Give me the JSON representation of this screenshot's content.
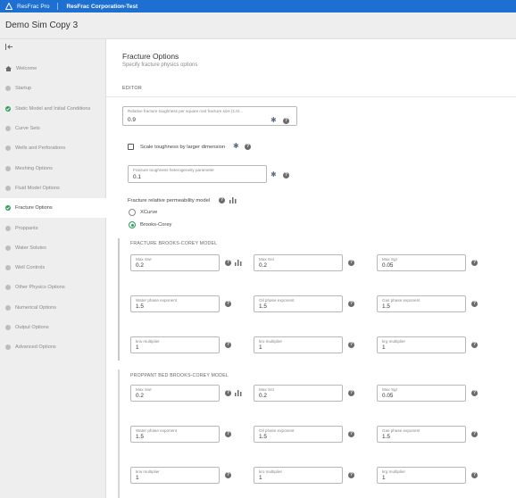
{
  "topbar": {
    "app": "ResFrac Pro",
    "org": "ResFrac Corporation-Test"
  },
  "sim": {
    "title": "Demo Sim Copy 3"
  },
  "sidebar": {
    "items": [
      {
        "label": "Welcome",
        "status": "home"
      },
      {
        "label": "Startup",
        "status": "none"
      },
      {
        "label": "Static Model and Initial Conditions",
        "status": "ok"
      },
      {
        "label": "Curve Sets",
        "status": "none"
      },
      {
        "label": "Wells and Perforations",
        "status": "none"
      },
      {
        "label": "Meshing Options",
        "status": "none"
      },
      {
        "label": "Fluid Model Options",
        "status": "none"
      },
      {
        "label": "Fracture Options",
        "status": "ok",
        "active": true
      },
      {
        "label": "Proppants",
        "status": "none"
      },
      {
        "label": "Water Solutes",
        "status": "none"
      },
      {
        "label": "Well Controls",
        "status": "none"
      },
      {
        "label": "Other Physics Options",
        "status": "none"
      },
      {
        "label": "Numerical Options",
        "status": "none"
      },
      {
        "label": "Output Options",
        "status": "none"
      },
      {
        "label": "Advanced Options",
        "status": "none"
      }
    ]
  },
  "main": {
    "title": "Fracture Options",
    "subtitle": "Specify fracture physics options",
    "tab": "EDITOR",
    "toughness": {
      "label": "Relative fracture toughness per square root fracture size (1.0/...",
      "value": "0.9"
    },
    "scale_label": "Scale toughness by larger dimension",
    "heterogeneity": {
      "label": "Fracture toughness heterogeneity parameter",
      "value": "0.1"
    },
    "relperm_label": "Fracture relative permeability model",
    "radio_xcurve": "XCurve",
    "radio_bc": "Brooks-Corey",
    "fracture_bc": {
      "heading": "FRACTURE BROOKS-COREY MODEL",
      "row1": [
        {
          "label": "Max Swr",
          "value": "0.2"
        },
        {
          "label": "Max Sor",
          "value": "0.2"
        },
        {
          "label": "Max Sgr",
          "value": "0.05"
        }
      ],
      "row2": [
        {
          "label": "Water phase exponent",
          "value": "1.5"
        },
        {
          "label": "Oil phase exponent",
          "value": "1.5"
        },
        {
          "label": "Gas phase exponent",
          "value": "1.5"
        }
      ],
      "row3": [
        {
          "label": "krw multiplier",
          "value": "1"
        },
        {
          "label": "kro multiplier",
          "value": "1"
        },
        {
          "label": "krg multiplier",
          "value": "1"
        }
      ]
    },
    "proppant_bc": {
      "heading": "PROPPANT BED BROOKS-COREY MODEL",
      "row1": [
        {
          "label": "Max Swr",
          "value": "0.2"
        },
        {
          "label": "Max Sor",
          "value": "0.2"
        },
        {
          "label": "Max Sgr",
          "value": "0.05"
        }
      ],
      "row2": [
        {
          "label": "Water phase exponent",
          "value": "1.5"
        },
        {
          "label": "Oil phase exponent",
          "value": "1.5"
        },
        {
          "label": "Gas phase exponent",
          "value": "1.5"
        }
      ],
      "row3": [
        {
          "label": "krw multiplier",
          "value": "1"
        },
        {
          "label": "kro multiplier",
          "value": "1"
        },
        {
          "label": "krg multiplier",
          "value": "1"
        }
      ]
    }
  },
  "colors": {
    "topbar": "#1d6fd1",
    "success": "#2e9d5b",
    "sidebar": "#eeeeee"
  }
}
